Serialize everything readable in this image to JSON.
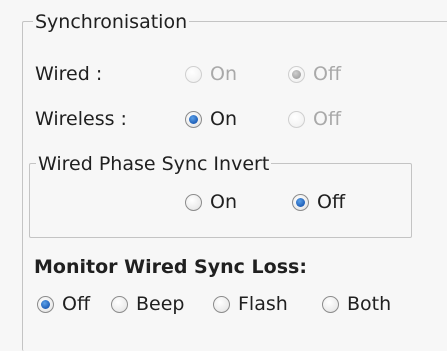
{
  "sync_group": {
    "title": "Synchronisation",
    "wired": {
      "label": "Wired :",
      "on_label": "On",
      "off_label": "Off",
      "selected": "Off",
      "enabled": false
    },
    "wireless": {
      "label": "Wireless :",
      "on_label": "On",
      "off_label": "Off",
      "selected": "On",
      "enabled": true
    }
  },
  "phase_invert_group": {
    "title": "Wired Phase Sync Invert",
    "on_label": "On",
    "off_label": "Off",
    "selected": "Off"
  },
  "monitor_loss": {
    "heading": "Monitor Wired Sync Loss:",
    "options": [
      "Off",
      "Beep",
      "Flash",
      "Both"
    ],
    "selected": "Off"
  }
}
